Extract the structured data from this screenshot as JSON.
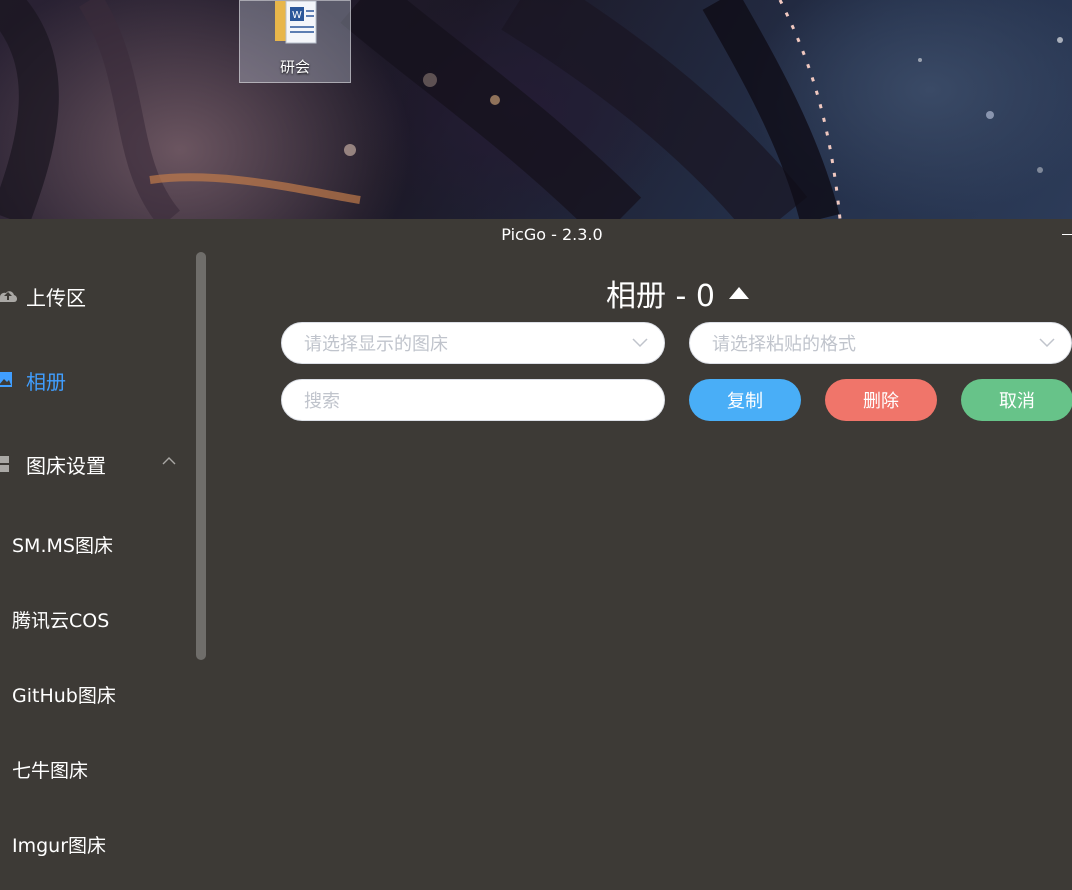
{
  "desktop": {
    "icon_label": "研会"
  },
  "window": {
    "title": "PicGo - 2.3.0"
  },
  "sidebar": {
    "items": [
      {
        "label": "上传区",
        "icon": "cloud-upload-icon"
      },
      {
        "label": "相册",
        "icon": "image-icon",
        "active": true
      },
      {
        "label": "图床设置",
        "icon": "grid-icon"
      }
    ],
    "sub_items": [
      "SM.MS图床",
      "腾讯云COS",
      "GitHub图床",
      "七牛图床",
      "Imgur图床"
    ]
  },
  "gallery": {
    "title": "相册 - 0",
    "bed_select_placeholder": "请选择显示的图床",
    "format_select_placeholder": "请选择粘贴的格式",
    "search_placeholder": "搜索",
    "copy_label": "复制",
    "delete_label": "删除",
    "cancel_label": "取消"
  },
  "colors": {
    "window_bg": "#3d3a36",
    "active": "#409eff",
    "copy": "#49aef7",
    "delete": "#f0756a",
    "cancel": "#67c389"
  }
}
